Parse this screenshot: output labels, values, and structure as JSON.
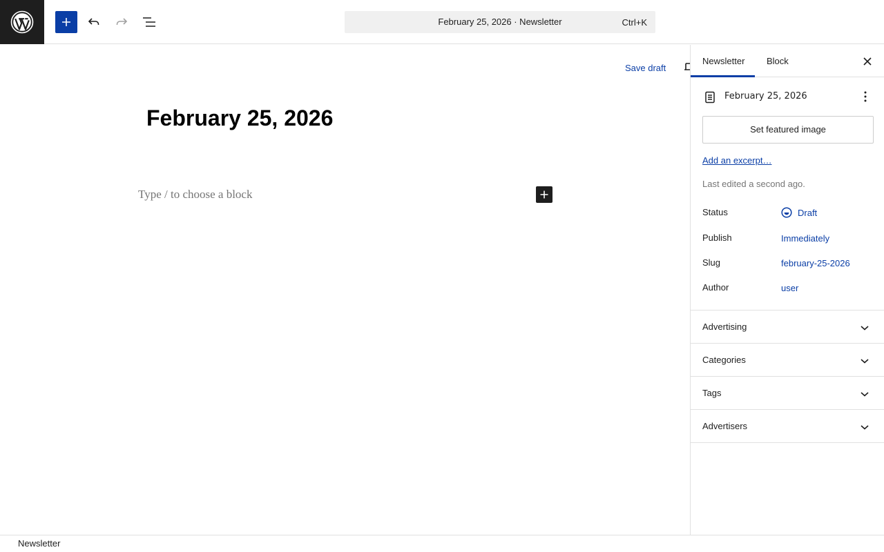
{
  "header": {
    "logo_icon": "wordpress-logo-icon",
    "add_block_icon": "plus-icon",
    "undo_icon": "undo-icon",
    "redo_icon": "redo-icon",
    "document_overview_icon": "list-view-icon",
    "command_bar": {
      "title": "February 25, 2026 · Newsletter",
      "shortcut": "Ctrl+K"
    },
    "accent_color": "#0a3ea6"
  },
  "editor": {
    "save_draft_label": "Save draft",
    "preview_icon": "desktop-preview-icon",
    "post_title": "February 25, 2026",
    "block_placeholder": "Type / to choose a block",
    "inline_add_icon": "plus-icon"
  },
  "sidebar": {
    "tabs": [
      {
        "label": "Newsletter",
        "active": true
      },
      {
        "label": "Block",
        "active": false
      }
    ],
    "close_icon": "close-icon",
    "summary": {
      "icon": "post-document-icon",
      "title": "February 25, 2026",
      "more_icon": "more-vertical-icon",
      "featured_image_label": "Set featured image",
      "excerpt_link": "Add an excerpt…",
      "last_edited": "Last edited a second ago.",
      "meta": [
        {
          "label": "Status",
          "value": "Draft",
          "icon": "draft-status-icon"
        },
        {
          "label": "Publish",
          "value": "Immediately"
        },
        {
          "label": "Slug",
          "value": "february-25-2026"
        },
        {
          "label": "Author",
          "value": "user"
        }
      ]
    },
    "panels": [
      {
        "title": "Advertising",
        "expanded": false
      },
      {
        "title": "Categories",
        "expanded": false
      },
      {
        "title": "Tags",
        "expanded": false
      },
      {
        "title": "Advertisers",
        "expanded": false
      }
    ],
    "panel_chevron_icon": "chevron-down-icon"
  },
  "footer": {
    "breadcrumb": "Newsletter"
  }
}
